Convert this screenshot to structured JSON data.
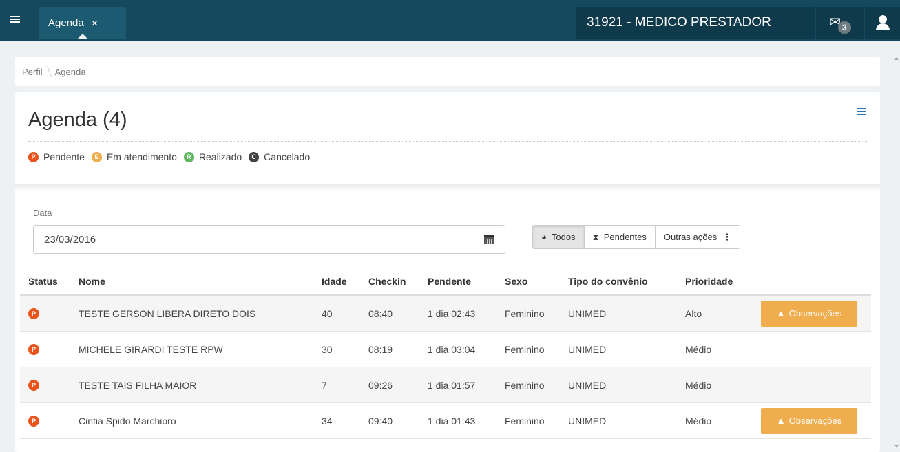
{
  "topbar": {
    "tab_label": "Agenda",
    "tab_close": "×",
    "user_title": "31921 - MEDICO PRESTADOR",
    "mail_glyph": "✉",
    "mail_count": "3",
    "icons": [
      "menu-icon",
      "mail-icon",
      "user-icon"
    ]
  },
  "breadcrumb": [
    "Perfil",
    "Agenda"
  ],
  "page": {
    "title": "Agenda (4)"
  },
  "legend": [
    {
      "code": "P",
      "label": "Pendente",
      "color": "#e8541c"
    },
    {
      "code": "E",
      "label": "Em atendimento",
      "color": "#f0ad4e"
    },
    {
      "code": "R",
      "label": "Realizado",
      "color": "#5cb85c"
    },
    {
      "code": "C",
      "label": "Cancelado",
      "color": "#444444"
    }
  ],
  "filters": {
    "date_label": "Data",
    "date_value": "23/03/2016",
    "buttons": {
      "todos": "Todos",
      "pendentes": "Pendentes",
      "outras": "Outras ações"
    },
    "glyphs": {
      "todos": "◕",
      "pendentes": "⧗",
      "kebab": "⋮"
    }
  },
  "table": {
    "headers": [
      "Status",
      "Nome",
      "Idade",
      "Checkin",
      "Pendente",
      "Sexo",
      "Tipo do convênio",
      "Prioridade"
    ],
    "rows": [
      {
        "status": "P",
        "nome": "TESTE GERSON LIBERA DIRETO DOIS",
        "idade": "40",
        "checkin": "08:40",
        "pendente": "1 dia 02:43",
        "sexo": "Feminino",
        "convenio": "UNIMED",
        "prioridade": "Alto",
        "acao": "Observações"
      },
      {
        "status": "P",
        "nome": "MICHELE GIRARDI TESTE RPW",
        "idade": "30",
        "checkin": "08:19",
        "pendente": "1 dia 03:04",
        "sexo": "Feminino",
        "convenio": "UNIMED",
        "prioridade": "Médio",
        "acao": ""
      },
      {
        "status": "P",
        "nome": "TESTE TAIS FILHA MAIOR",
        "idade": "7",
        "checkin": "09:26",
        "pendente": "1 dia 01:57",
        "sexo": "Feminino",
        "convenio": "UNIMED",
        "prioridade": "Médio",
        "acao": ""
      },
      {
        "status": "P",
        "nome": "Cintia Spido Marchioro",
        "idade": "34",
        "checkin": "09:40",
        "pendente": "1 dia 01:43",
        "sexo": "Feminino",
        "convenio": "UNIMED",
        "prioridade": "Médio",
        "acao": "Observações"
      }
    ],
    "warn_glyph": "▲"
  }
}
